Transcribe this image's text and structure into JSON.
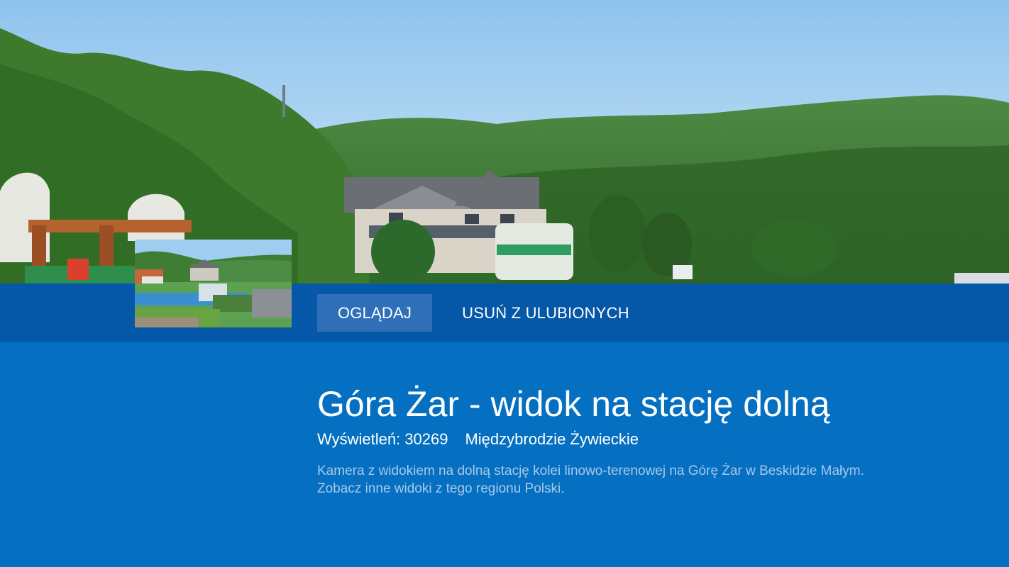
{
  "hero": {
    "image": "mountain-valley-cable-station-photo",
    "sky_color": "#a9d3f2",
    "forest_color": "#3f7a2c"
  },
  "thumbnail": {
    "image": "amusement-park-station-thumbnail"
  },
  "actions": {
    "watch_label": "OGLĄDAJ",
    "remove_favorite_label": "USUŃ Z ULUBIONYCH"
  },
  "details": {
    "title": "Góra Żar - widok na stację dolną",
    "views": "Wyświetleń: 30269",
    "location": "Międzybrodzie Żywieckie",
    "description_line1": "Kamera z widokiem na dolną stację kolei linowo-terenowej na Górę Żar w Beskidzie Małym.",
    "description_line2": "Zobacz inne widoki z tego regionu Polski."
  },
  "colors": {
    "background": "#0570c1",
    "action_bar": "#0557a7",
    "button_focused": "#2e6fb8",
    "description_text": "#a7c8ea"
  }
}
